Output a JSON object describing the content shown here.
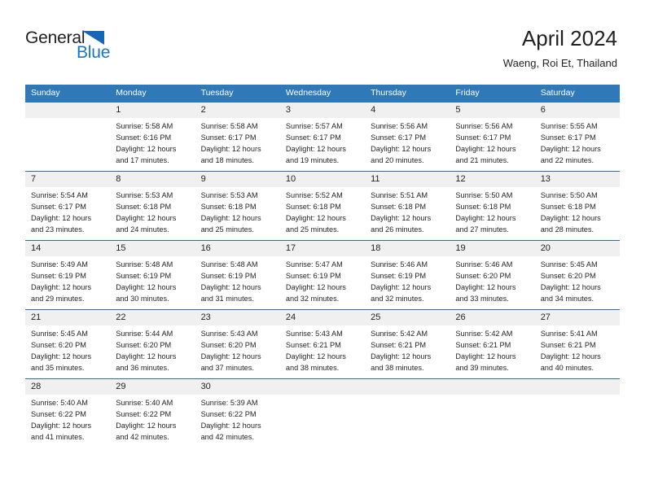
{
  "brand": {
    "name_part1": "General",
    "name_part2": "Blue",
    "triangle_icon": "blue-triangle-icon",
    "accent_color": "#1975c1"
  },
  "header": {
    "month_year": "April 2024",
    "location": "Waeng, Roi Et, Thailand"
  },
  "theme": {
    "header_band": "#3079b8",
    "week_divider": "#2e6ca4",
    "daynum_band": "#f0f0f0",
    "text": "#231f20"
  },
  "weekday_headers": [
    "Sunday",
    "Monday",
    "Tuesday",
    "Wednesday",
    "Thursday",
    "Friday",
    "Saturday"
  ],
  "weeks": [
    {
      "days": [
        {
          "date": "",
          "sunrise": "",
          "sunset": "",
          "daylight_line1": "",
          "daylight_line2": "",
          "empty": true
        },
        {
          "date": "1",
          "sunrise": "Sunrise: 5:58 AM",
          "sunset": "Sunset: 6:16 PM",
          "daylight_line1": "Daylight: 12 hours",
          "daylight_line2": "and 17 minutes.",
          "empty": false
        },
        {
          "date": "2",
          "sunrise": "Sunrise: 5:58 AM",
          "sunset": "Sunset: 6:17 PM",
          "daylight_line1": "Daylight: 12 hours",
          "daylight_line2": "and 18 minutes.",
          "empty": false
        },
        {
          "date": "3",
          "sunrise": "Sunrise: 5:57 AM",
          "sunset": "Sunset: 6:17 PM",
          "daylight_line1": "Daylight: 12 hours",
          "daylight_line2": "and 19 minutes.",
          "empty": false
        },
        {
          "date": "4",
          "sunrise": "Sunrise: 5:56 AM",
          "sunset": "Sunset: 6:17 PM",
          "daylight_line1": "Daylight: 12 hours",
          "daylight_line2": "and 20 minutes.",
          "empty": false
        },
        {
          "date": "5",
          "sunrise": "Sunrise: 5:56 AM",
          "sunset": "Sunset: 6:17 PM",
          "daylight_line1": "Daylight: 12 hours",
          "daylight_line2": "and 21 minutes.",
          "empty": false
        },
        {
          "date": "6",
          "sunrise": "Sunrise: 5:55 AM",
          "sunset": "Sunset: 6:17 PM",
          "daylight_line1": "Daylight: 12 hours",
          "daylight_line2": "and 22 minutes.",
          "empty": false
        }
      ]
    },
    {
      "days": [
        {
          "date": "7",
          "sunrise": "Sunrise: 5:54 AM",
          "sunset": "Sunset: 6:17 PM",
          "daylight_line1": "Daylight: 12 hours",
          "daylight_line2": "and 23 minutes.",
          "empty": false
        },
        {
          "date": "8",
          "sunrise": "Sunrise: 5:53 AM",
          "sunset": "Sunset: 6:18 PM",
          "daylight_line1": "Daylight: 12 hours",
          "daylight_line2": "and 24 minutes.",
          "empty": false
        },
        {
          "date": "9",
          "sunrise": "Sunrise: 5:53 AM",
          "sunset": "Sunset: 6:18 PM",
          "daylight_line1": "Daylight: 12 hours",
          "daylight_line2": "and 25 minutes.",
          "empty": false
        },
        {
          "date": "10",
          "sunrise": "Sunrise: 5:52 AM",
          "sunset": "Sunset: 6:18 PM",
          "daylight_line1": "Daylight: 12 hours",
          "daylight_line2": "and 25 minutes.",
          "empty": false
        },
        {
          "date": "11",
          "sunrise": "Sunrise: 5:51 AM",
          "sunset": "Sunset: 6:18 PM",
          "daylight_line1": "Daylight: 12 hours",
          "daylight_line2": "and 26 minutes.",
          "empty": false
        },
        {
          "date": "12",
          "sunrise": "Sunrise: 5:50 AM",
          "sunset": "Sunset: 6:18 PM",
          "daylight_line1": "Daylight: 12 hours",
          "daylight_line2": "and 27 minutes.",
          "empty": false
        },
        {
          "date": "13",
          "sunrise": "Sunrise: 5:50 AM",
          "sunset": "Sunset: 6:18 PM",
          "daylight_line1": "Daylight: 12 hours",
          "daylight_line2": "and 28 minutes.",
          "empty": false
        }
      ]
    },
    {
      "days": [
        {
          "date": "14",
          "sunrise": "Sunrise: 5:49 AM",
          "sunset": "Sunset: 6:19 PM",
          "daylight_line1": "Daylight: 12 hours",
          "daylight_line2": "and 29 minutes.",
          "empty": false
        },
        {
          "date": "15",
          "sunrise": "Sunrise: 5:48 AM",
          "sunset": "Sunset: 6:19 PM",
          "daylight_line1": "Daylight: 12 hours",
          "daylight_line2": "and 30 minutes.",
          "empty": false
        },
        {
          "date": "16",
          "sunrise": "Sunrise: 5:48 AM",
          "sunset": "Sunset: 6:19 PM",
          "daylight_line1": "Daylight: 12 hours",
          "daylight_line2": "and 31 minutes.",
          "empty": false
        },
        {
          "date": "17",
          "sunrise": "Sunrise: 5:47 AM",
          "sunset": "Sunset: 6:19 PM",
          "daylight_line1": "Daylight: 12 hours",
          "daylight_line2": "and 32 minutes.",
          "empty": false
        },
        {
          "date": "18",
          "sunrise": "Sunrise: 5:46 AM",
          "sunset": "Sunset: 6:19 PM",
          "daylight_line1": "Daylight: 12 hours",
          "daylight_line2": "and 32 minutes.",
          "empty": false
        },
        {
          "date": "19",
          "sunrise": "Sunrise: 5:46 AM",
          "sunset": "Sunset: 6:20 PM",
          "daylight_line1": "Daylight: 12 hours",
          "daylight_line2": "and 33 minutes.",
          "empty": false
        },
        {
          "date": "20",
          "sunrise": "Sunrise: 5:45 AM",
          "sunset": "Sunset: 6:20 PM",
          "daylight_line1": "Daylight: 12 hours",
          "daylight_line2": "and 34 minutes.",
          "empty": false
        }
      ]
    },
    {
      "days": [
        {
          "date": "21",
          "sunrise": "Sunrise: 5:45 AM",
          "sunset": "Sunset: 6:20 PM",
          "daylight_line1": "Daylight: 12 hours",
          "daylight_line2": "and 35 minutes.",
          "empty": false
        },
        {
          "date": "22",
          "sunrise": "Sunrise: 5:44 AM",
          "sunset": "Sunset: 6:20 PM",
          "daylight_line1": "Daylight: 12 hours",
          "daylight_line2": "and 36 minutes.",
          "empty": false
        },
        {
          "date": "23",
          "sunrise": "Sunrise: 5:43 AM",
          "sunset": "Sunset: 6:20 PM",
          "daylight_line1": "Daylight: 12 hours",
          "daylight_line2": "and 37 minutes.",
          "empty": false
        },
        {
          "date": "24",
          "sunrise": "Sunrise: 5:43 AM",
          "sunset": "Sunset: 6:21 PM",
          "daylight_line1": "Daylight: 12 hours",
          "daylight_line2": "and 38 minutes.",
          "empty": false
        },
        {
          "date": "25",
          "sunrise": "Sunrise: 5:42 AM",
          "sunset": "Sunset: 6:21 PM",
          "daylight_line1": "Daylight: 12 hours",
          "daylight_line2": "and 38 minutes.",
          "empty": false
        },
        {
          "date": "26",
          "sunrise": "Sunrise: 5:42 AM",
          "sunset": "Sunset: 6:21 PM",
          "daylight_line1": "Daylight: 12 hours",
          "daylight_line2": "and 39 minutes.",
          "empty": false
        },
        {
          "date": "27",
          "sunrise": "Sunrise: 5:41 AM",
          "sunset": "Sunset: 6:21 PM",
          "daylight_line1": "Daylight: 12 hours",
          "daylight_line2": "and 40 minutes.",
          "empty": false
        }
      ]
    },
    {
      "days": [
        {
          "date": "28",
          "sunrise": "Sunrise: 5:40 AM",
          "sunset": "Sunset: 6:22 PM",
          "daylight_line1": "Daylight: 12 hours",
          "daylight_line2": "and 41 minutes.",
          "empty": false
        },
        {
          "date": "29",
          "sunrise": "Sunrise: 5:40 AM",
          "sunset": "Sunset: 6:22 PM",
          "daylight_line1": "Daylight: 12 hours",
          "daylight_line2": "and 42 minutes.",
          "empty": false
        },
        {
          "date": "30",
          "sunrise": "Sunrise: 5:39 AM",
          "sunset": "Sunset: 6:22 PM",
          "daylight_line1": "Daylight: 12 hours",
          "daylight_line2": "and 42 minutes.",
          "empty": false
        },
        {
          "date": "",
          "sunrise": "",
          "sunset": "",
          "daylight_line1": "",
          "daylight_line2": "",
          "empty": true
        },
        {
          "date": "",
          "sunrise": "",
          "sunset": "",
          "daylight_line1": "",
          "daylight_line2": "",
          "empty": true
        },
        {
          "date": "",
          "sunrise": "",
          "sunset": "",
          "daylight_line1": "",
          "daylight_line2": "",
          "empty": true
        },
        {
          "date": "",
          "sunrise": "",
          "sunset": "",
          "daylight_line1": "",
          "daylight_line2": "",
          "empty": true
        }
      ]
    }
  ]
}
